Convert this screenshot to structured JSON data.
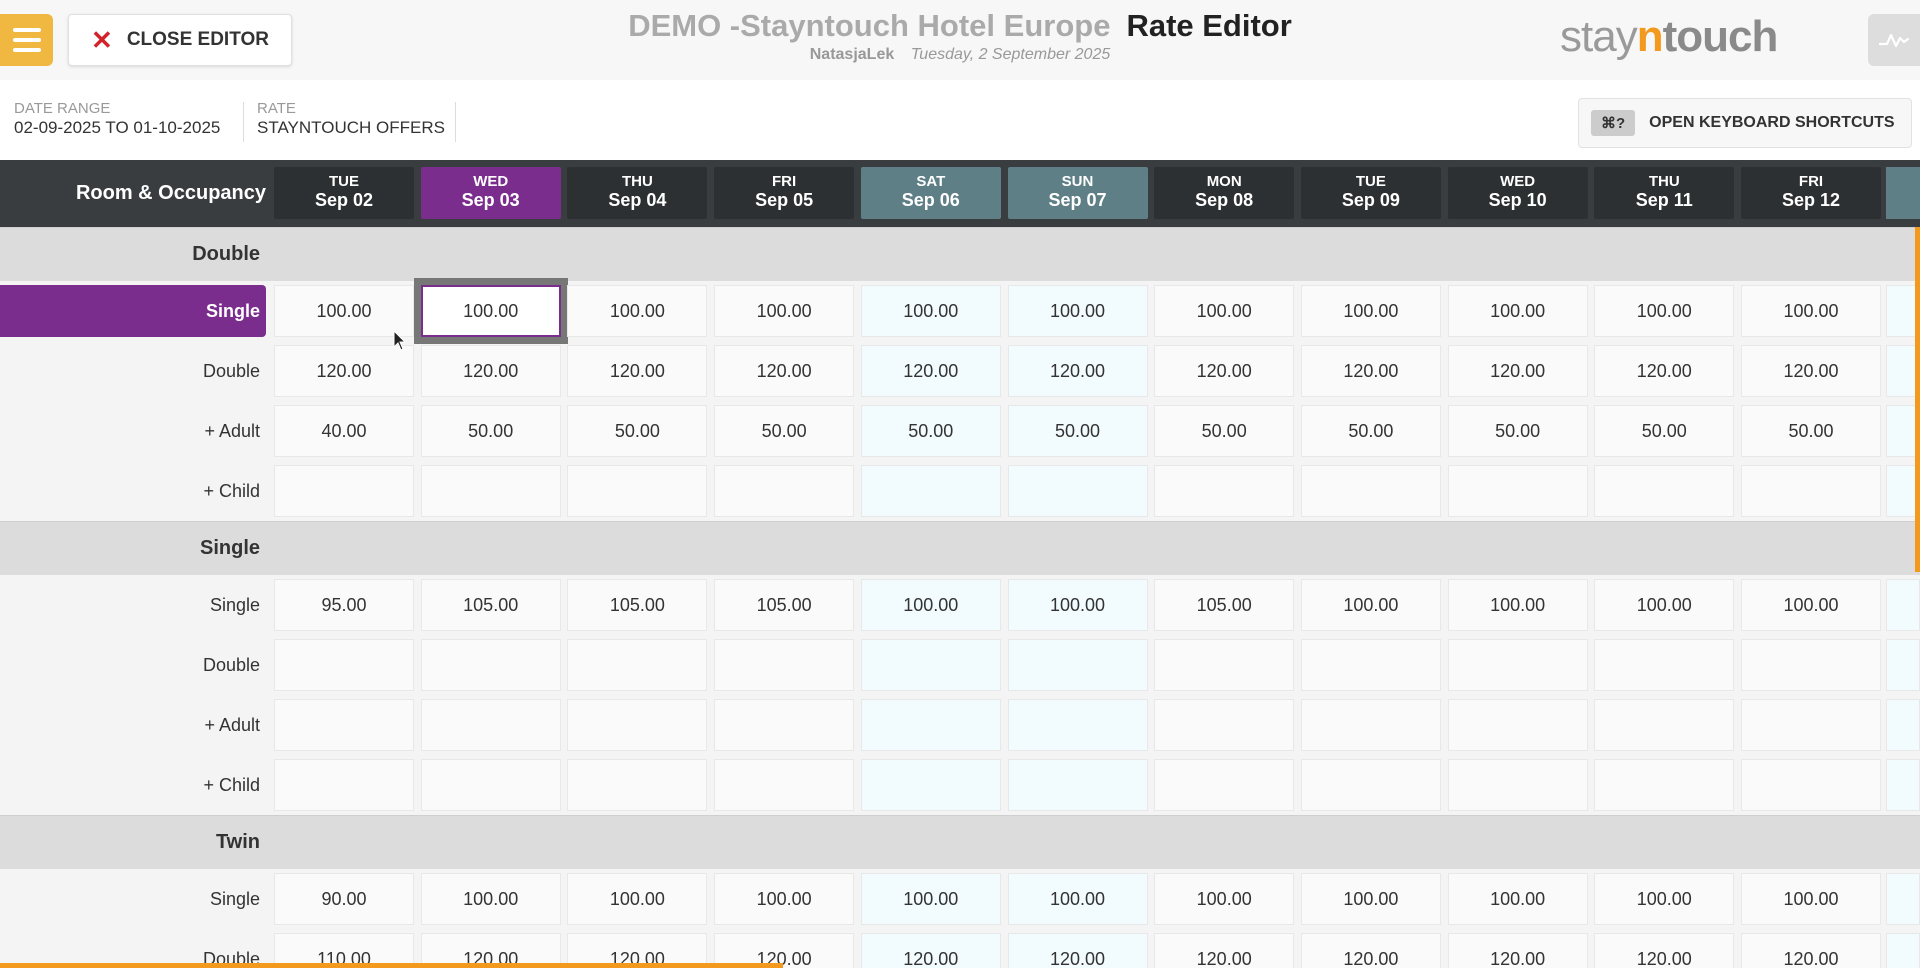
{
  "header": {
    "close_label": "CLOSE EDITOR",
    "hotel_name": "DEMO -Stayntouch Hotel Europe",
    "page_title": "Rate Editor",
    "user": "NatasjaLek",
    "date": "Tuesday, 2 September 2025",
    "logo": {
      "pre": "stay",
      "n": "n",
      "post": "touch"
    }
  },
  "filters": {
    "date_range_label": "DATE RANGE",
    "date_range_value": "02-09-2025 TO 01-10-2025",
    "rate_label": "RATE",
    "rate_value": "STAYNTOUCH OFFERS",
    "shortcut_key": "⌘?",
    "shortcuts_label": "OPEN KEYBOARD SHORTCUTS"
  },
  "grid": {
    "row_header_label": "Room & Occupancy",
    "days": [
      {
        "dow": "TUE",
        "date": "Sep 02",
        "weekend": false,
        "selected": false
      },
      {
        "dow": "WED",
        "date": "Sep 03",
        "weekend": false,
        "selected": true
      },
      {
        "dow": "THU",
        "date": "Sep 04",
        "weekend": false,
        "selected": false
      },
      {
        "dow": "FRI",
        "date": "Sep 05",
        "weekend": false,
        "selected": false
      },
      {
        "dow": "SAT",
        "date": "Sep 06",
        "weekend": true,
        "selected": false
      },
      {
        "dow": "SUN",
        "date": "Sep 07",
        "weekend": true,
        "selected": false
      },
      {
        "dow": "MON",
        "date": "Sep 08",
        "weekend": false,
        "selected": false
      },
      {
        "dow": "TUE",
        "date": "Sep 09",
        "weekend": false,
        "selected": false
      },
      {
        "dow": "WED",
        "date": "Sep 10",
        "weekend": false,
        "selected": false
      },
      {
        "dow": "THU",
        "date": "Sep 11",
        "weekend": false,
        "selected": false
      },
      {
        "dow": "FRI",
        "date": "Sep 12",
        "weekend": false,
        "selected": false
      }
    ],
    "room_types": [
      {
        "name": "Double",
        "rows": [
          {
            "label": "Single",
            "active": true,
            "values": [
              "100.00",
              "100.00",
              "100.00",
              "100.00",
              "100.00",
              "100.00",
              "100.00",
              "100.00",
              "100.00",
              "100.00",
              "100.00"
            ]
          },
          {
            "label": "Double",
            "values": [
              "120.00",
              "120.00",
              "120.00",
              "120.00",
              "120.00",
              "120.00",
              "120.00",
              "120.00",
              "120.00",
              "120.00",
              "120.00"
            ]
          },
          {
            "label": "+ Adult",
            "values": [
              "40.00",
              "50.00",
              "50.00",
              "50.00",
              "50.00",
              "50.00",
              "50.00",
              "50.00",
              "50.00",
              "50.00",
              "50.00"
            ]
          },
          {
            "label": "+ Child",
            "values": [
              "",
              "",
              "",
              "",
              "",
              "",
              "",
              "",
              "",
              "",
              ""
            ]
          }
        ]
      },
      {
        "name": "Single",
        "rows": [
          {
            "label": "Single",
            "values": [
              "95.00",
              "105.00",
              "105.00",
              "105.00",
              "100.00",
              "100.00",
              "105.00",
              "100.00",
              "100.00",
              "100.00",
              "100.00"
            ]
          },
          {
            "label": "Double",
            "values": [
              "",
              "",
              "",
              "",
              "",
              "",
              "",
              "",
              "",
              "",
              ""
            ]
          },
          {
            "label": "+ Adult",
            "values": [
              "",
              "",
              "",
              "",
              "",
              "",
              "",
              "",
              "",
              "",
              ""
            ]
          },
          {
            "label": "+ Child",
            "values": [
              "",
              "",
              "",
              "",
              "",
              "",
              "",
              "",
              "",
              "",
              ""
            ]
          }
        ]
      },
      {
        "name": "Twin",
        "rows": [
          {
            "label": "Single",
            "values": [
              "90.00",
              "100.00",
              "100.00",
              "100.00",
              "100.00",
              "100.00",
              "100.00",
              "100.00",
              "100.00",
              "100.00",
              "100.00"
            ]
          },
          {
            "label": "Double",
            "values": [
              "110.00",
              "120.00",
              "120.00",
              "120.00",
              "120.00",
              "120.00",
              "120.00",
              "120.00",
              "120.00",
              "120.00",
              "120.00"
            ]
          }
        ]
      }
    ],
    "selected_cell": {
      "room_type": 0,
      "row": 0,
      "day": 1
    }
  },
  "icons": [
    "hamburger-menu-icon",
    "close-icon",
    "activity-chart-icon",
    "cursor-icon"
  ],
  "colors": {
    "accent": "#7b2d8e",
    "brand": "#f39a1e",
    "menu": "#f0b840",
    "close": "#d2232a",
    "weekend": "#5f7f87"
  }
}
